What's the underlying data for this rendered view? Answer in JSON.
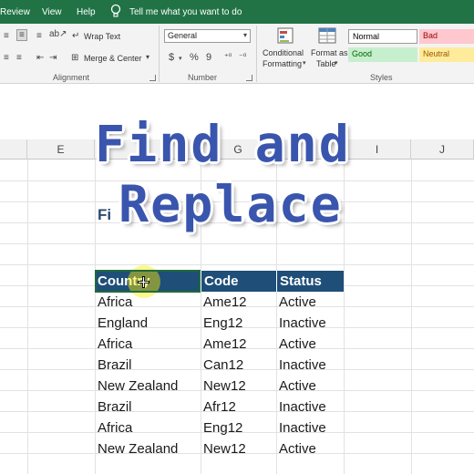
{
  "menubar": {
    "items": [
      "Review",
      "View",
      "Help"
    ],
    "tell_me": "Tell me what you want to do"
  },
  "ribbon": {
    "alignment": {
      "wrap_text": "Wrap Text",
      "merge_center": "Merge & Center",
      "group_label": "Alignment"
    },
    "number": {
      "format_value": "General",
      "currency": "$",
      "percent": "%",
      "comma": "9",
      "group_label": "Number"
    },
    "styles": {
      "conditional_formatting": [
        "Conditional",
        "Formatting"
      ],
      "format_as_table": [
        "Format as",
        "Table"
      ],
      "cells": [
        {
          "label": "Normal",
          "bg": "#ffffff",
          "fg": "#000000"
        },
        {
          "label": "Bad",
          "bg": "#ffc7ce",
          "fg": "#9c0006"
        },
        {
          "label": "Good",
          "bg": "#c6efce",
          "fg": "#006100"
        },
        {
          "label": "Neutral",
          "bg": "#ffeb9c",
          "fg": "#9c5700"
        }
      ],
      "group_label": "Styles"
    }
  },
  "columns": [
    "E",
    "G",
    "I",
    "J"
  ],
  "sheet": {
    "heading_partial": "Fi"
  },
  "table": {
    "headers": [
      "Country",
      "Code",
      "Status"
    ],
    "rows": [
      [
        "Africa",
        "Ame12",
        "Active"
      ],
      [
        "England",
        "Eng12",
        "Inactive"
      ],
      [
        "Africa",
        "Ame12",
        "Active"
      ],
      [
        "Brazil",
        "Can12",
        "Inactive"
      ],
      [
        "New Zealand",
        "New12",
        "Active"
      ],
      [
        "Brazil",
        "Afr12",
        "Inactive"
      ],
      [
        "Africa",
        "Eng12",
        "Inactive"
      ],
      [
        "New Zealand",
        "New12",
        "Active"
      ]
    ]
  },
  "overlay": {
    "line1": "Find and",
    "line2": "Replace"
  },
  "colors": {
    "excel_green": "#217346",
    "table_header": "#1f4e79",
    "overlay_text": "#3a55ad"
  }
}
